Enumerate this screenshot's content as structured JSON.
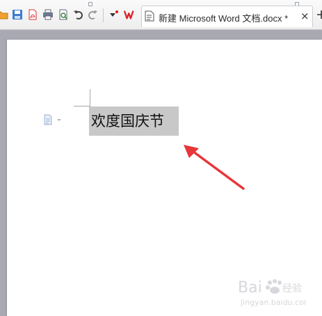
{
  "toolbar": {
    "buttons": [
      {
        "icon": "open-folder-icon"
      },
      {
        "icon": "save-icon"
      },
      {
        "icon": "export-pdf-icon"
      },
      {
        "icon": "print-icon"
      },
      {
        "icon": "print-preview-icon"
      },
      {
        "icon": "undo-icon"
      },
      {
        "icon": "redo-icon"
      },
      {
        "icon": "customize-dropdown-icon"
      },
      {
        "icon": "wps-logo-icon"
      }
    ]
  },
  "tab": {
    "title": "新建 Microsoft Word 文档.docx *",
    "close_label": "×"
  },
  "document": {
    "text": "欢度国庆节"
  },
  "watermark": {
    "brand": "Bai",
    "brand_suffix": "经验",
    "url": "jingyan.baidu.com"
  },
  "colors": {
    "selection": "#c8c8c8",
    "arrow": "#e8363a",
    "wps_red": "#d9262b",
    "canvas": "#a9a9b3"
  }
}
